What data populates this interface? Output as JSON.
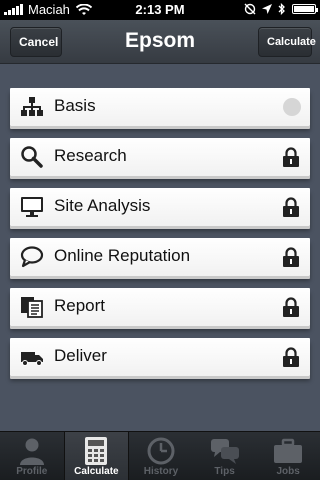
{
  "status_bar": {
    "carrier": "Maciah",
    "time": "2:13 PM"
  },
  "nav": {
    "title": "Epsom",
    "left_button": "Cancel",
    "right_button": "Calculate"
  },
  "menu": {
    "items": [
      {
        "label": "Basis",
        "icon": "hierarchy-icon",
        "trail": "status-dot"
      },
      {
        "label": "Research",
        "icon": "search-icon",
        "trail": "lock-icon"
      },
      {
        "label": "Site Analysis",
        "icon": "monitor-icon",
        "trail": "lock-icon"
      },
      {
        "label": "Online Reputation",
        "icon": "speech-bubble-icon",
        "trail": "lock-icon"
      },
      {
        "label": "Report",
        "icon": "documents-icon",
        "trail": "lock-icon"
      },
      {
        "label": "Deliver",
        "icon": "truck-icon",
        "trail": "lock-icon"
      }
    ]
  },
  "tab_bar": {
    "tabs": [
      {
        "label": "Profile",
        "icon": "person-icon",
        "active": false
      },
      {
        "label": "Calculate",
        "icon": "calculator-icon",
        "active": true
      },
      {
        "label": "History",
        "icon": "clock-icon",
        "active": false
      },
      {
        "label": "Tips",
        "icon": "chat-icon",
        "active": false
      },
      {
        "label": "Jobs",
        "icon": "briefcase-icon",
        "active": false
      }
    ]
  },
  "colors": {
    "background": "#4b5361",
    "card": "#ffffff",
    "nav": "#3f454c",
    "tab_inactive": "#5d6167"
  }
}
